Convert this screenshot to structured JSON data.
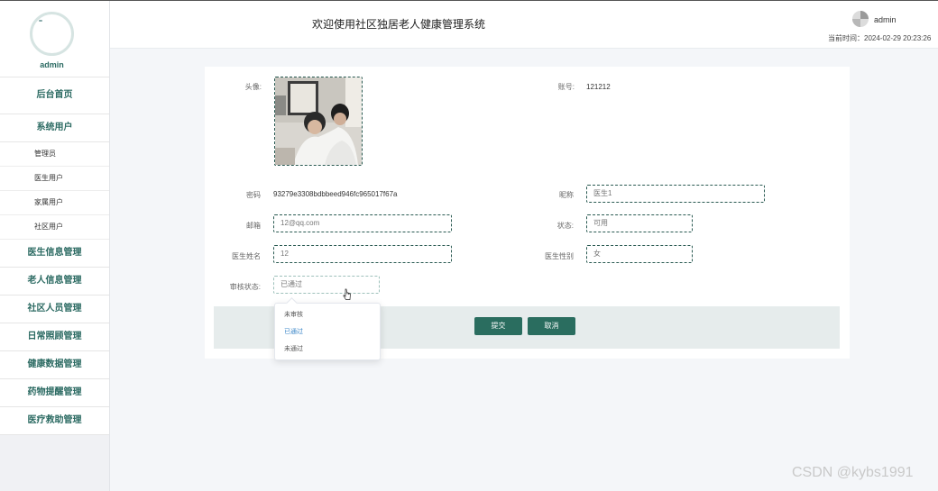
{
  "sidebar": {
    "username": "admin",
    "items": [
      {
        "label": "后台首页",
        "type": "item"
      },
      {
        "label": "系统用户",
        "type": "group"
      },
      {
        "label": "管理员",
        "type": "sub"
      },
      {
        "label": "医生用户",
        "type": "sub"
      },
      {
        "label": "家属用户",
        "type": "sub"
      },
      {
        "label": "社区用户",
        "type": "sub"
      },
      {
        "label": "医生信息管理",
        "type": "item"
      },
      {
        "label": "老人信息管理",
        "type": "item"
      },
      {
        "label": "社区人员管理",
        "type": "item"
      },
      {
        "label": "日常照顾管理",
        "type": "item"
      },
      {
        "label": "健康数据管理",
        "type": "item"
      },
      {
        "label": "药物提醒管理",
        "type": "item"
      },
      {
        "label": "医疗救助管理",
        "type": "item"
      }
    ]
  },
  "header": {
    "title": "欢迎使用社区独居老人健康管理系统",
    "username": "admin",
    "time_label": "当前时间：",
    "time_value": "2024-02-29 20:23:26"
  },
  "form": {
    "avatar_label": "头像:",
    "account_label": "账号:",
    "account_value": "121212",
    "password_label": "密码",
    "password_value": "93279e3308bdbbeed946fc965017f67a",
    "nickname_label": "昵称",
    "nickname_value": "医生1",
    "email_label": "邮箱",
    "email_value": "12@qq.com",
    "status_label": "状态:",
    "status_value": "可用",
    "doctor_name_label": "医生姓名",
    "doctor_name_value": "12",
    "doctor_gender_label": "医生性别",
    "doctor_gender_value": "女",
    "audit_label": "审核状态:",
    "audit_value": "已通过",
    "submit_label": "提交",
    "cancel_label": "取消"
  },
  "dropdown": {
    "options": [
      "未审核",
      "已通过",
      "未通过"
    ],
    "selected_index": 1
  },
  "watermark": "CSDN @kybs1991",
  "colors": {
    "accent": "#2a6d5f",
    "menu_text": "#2b6a62",
    "selected_option": "#3a86c8"
  }
}
